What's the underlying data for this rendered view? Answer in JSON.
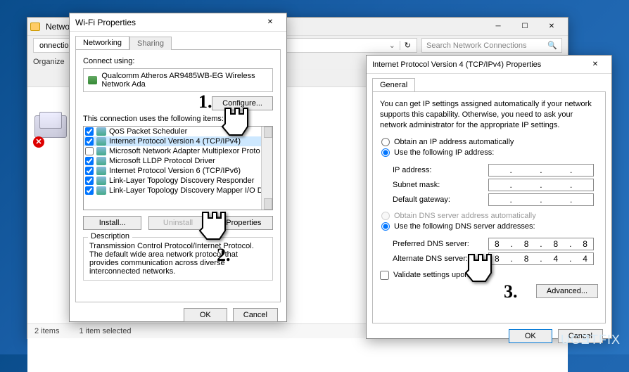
{
  "netwin": {
    "title": "Network",
    "breadcrumb": "onnections  ›",
    "search_placeholder": "Search Network Connections",
    "organize": "Organize",
    "status_items": "2 items",
    "status_selected": "1 item selected"
  },
  "wifi": {
    "title": "Wi-Fi Properties",
    "tab_networking": "Networking",
    "tab_sharing": "Sharing",
    "connect_using": "Connect using:",
    "adapter": "Qualcomm Atheros AR9485WB-EG Wireless Network Ada",
    "configure": "Configure...",
    "items_label": "This connection uses the following items:",
    "items": [
      {
        "label": "QoS Packet Scheduler",
        "checked": true
      },
      {
        "label": "Internet Protocol Version 4 (TCP/IPv4)",
        "checked": true,
        "selected": true
      },
      {
        "label": "Microsoft Network Adapter Multiplexor Proto",
        "checked": false
      },
      {
        "label": "Microsoft LLDP Protocol Driver",
        "checked": true
      },
      {
        "label": "Internet Protocol Version 6 (TCP/IPv6)",
        "checked": true
      },
      {
        "label": "Link-Layer Topology Discovery Responder",
        "checked": true
      },
      {
        "label": "Link-Layer Topology Discovery Mapper I/O Driver",
        "checked": true
      }
    ],
    "install": "Install...",
    "uninstall": "Uninstall",
    "properties": "Properties",
    "desc_legend": "Description",
    "desc_text": "Transmission Control Protocol/Internet Protocol. The default wide area network protocol that provides communication across diverse interconnected networks.",
    "ok": "OK",
    "cancel": "Cancel"
  },
  "ip": {
    "title": "Internet Protocol Version 4 (TCP/IPv4) Properties",
    "tab_general": "General",
    "info": "You can get IP settings assigned automatically if your network supports this capability. Otherwise, you need to ask your network administrator for the appropriate IP settings.",
    "radio_auto_ip": "Obtain an IP address automatically",
    "radio_use_ip": "Use the following IP address:",
    "ip_address": "IP address:",
    "subnet": "Subnet mask:",
    "gateway": "Default gateway:",
    "radio_auto_dns": "Obtain DNS server address automatically",
    "radio_use_dns": "Use the following DNS server addresses:",
    "pref_dns": "Preferred DNS server:",
    "alt_dns": "Alternate DNS server:",
    "pref_val": [
      "8",
      "8",
      "8",
      "8"
    ],
    "alt_val": [
      "8",
      "8",
      "4",
      "4"
    ],
    "validate": "Validate settings upon exit",
    "advanced": "Advanced...",
    "ok": "OK",
    "cancel": "Cancel"
  },
  "anno": {
    "n1": "1.",
    "n2": "2.",
    "n3": "3."
  },
  "watermark": "UGETFIX"
}
